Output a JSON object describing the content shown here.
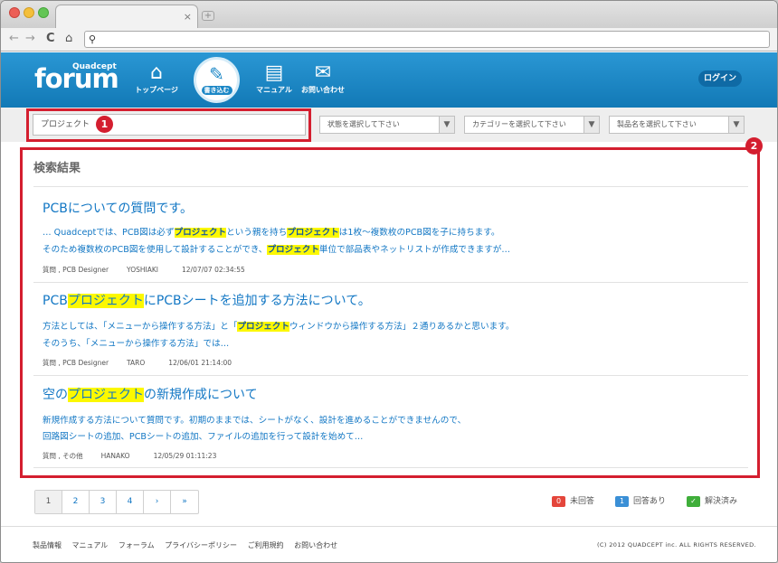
{
  "browser": {
    "tab_close": "×",
    "newtab": "+",
    "back": "←",
    "forward": "→",
    "reload": "C",
    "home": "⌂",
    "search_icon": "⚲"
  },
  "header": {
    "logo_small": "Quadcept",
    "logo": "forum",
    "nav": [
      {
        "icon": "home-icon",
        "glyph": "⌂",
        "label": "トップページ"
      },
      {
        "icon": "pen-icon",
        "glyph": "✎",
        "label": "書き込む"
      },
      {
        "icon": "manual-icon",
        "glyph": "▤",
        "label": "マニュアル"
      },
      {
        "icon": "mail-icon",
        "glyph": "✉",
        "label": "お問い合わせ"
      }
    ],
    "login": "ログイン"
  },
  "search": {
    "keyword": "プロジェクト",
    "status_placeholder": "状態を選択して下さい",
    "category_placeholder": "カテゴリーを選択して下さい",
    "product_placeholder": "製品名を選択して下さい",
    "arrow": "▼"
  },
  "annotations": {
    "badge1": "1",
    "badge2": "2"
  },
  "results": {
    "heading": "検索結果",
    "items": [
      {
        "title": "PCBについての質問です。",
        "line1": [
          "… Quadceptでは、PCB図は必ず",
          "プロジェクト",
          "という親を持ち",
          "プロジェクト",
          "は1枚〜複数枚のPCB図を子に持ちます。"
        ],
        "line2": [
          "そのため複数枚のPCB図を使用して設計することができ、",
          "プロジェクト",
          "単位で部品表やネットリストが作成できますが…"
        ],
        "category": "質問 , PCB Designer",
        "user": "YOSHIAKI",
        "date": "12/07/07 02:34:55"
      },
      {
        "title": [
          "PCB",
          "プロジェクト",
          "にPCBシートを追加する方法について。"
        ],
        "line1": [
          "方法としては、「メニューから操作する方法」と「",
          "プロジェクト",
          "ウィンドウから操作する方法」２通りあるかと思います。"
        ],
        "line2": "そのうち、「メニューから操作する方法」では…",
        "category": "質問 , PCB Designer",
        "user": "TARO",
        "date": "12/06/01 21:14:00"
      },
      {
        "title": [
          "空の",
          "プロジェクト",
          "の新規作成について"
        ],
        "line1": "新規作成する方法について質問です。初期のままでは、シートがなく、設計を進めることができませんので、",
        "line2": "回路図シートの追加、PCBシートの追加、ファイルの追加を行って設計を始めて…",
        "category": "質問 , その他",
        "user": "HANAKO",
        "date": "12/05/29 01:11:23"
      }
    ]
  },
  "pager": [
    "1",
    "2",
    "3",
    "4",
    "›",
    "»"
  ],
  "legend": [
    {
      "count": "0",
      "label": "未回答",
      "color": "#e4463b"
    },
    {
      "count": "1",
      "label": "回答あり",
      "color": "#3a8fd6"
    },
    {
      "count": "✓",
      "label": "解決済み",
      "color": "#3fae3a"
    }
  ],
  "footer": {
    "links": [
      "製品情報",
      "マニュアル",
      "フォーラム",
      "プライバシーポリシー",
      "ご利用規約",
      "お問い合わせ"
    ],
    "copyright": "(C) 2012 QUADCEPT inc. ALL RIGHTS RESERVED."
  }
}
